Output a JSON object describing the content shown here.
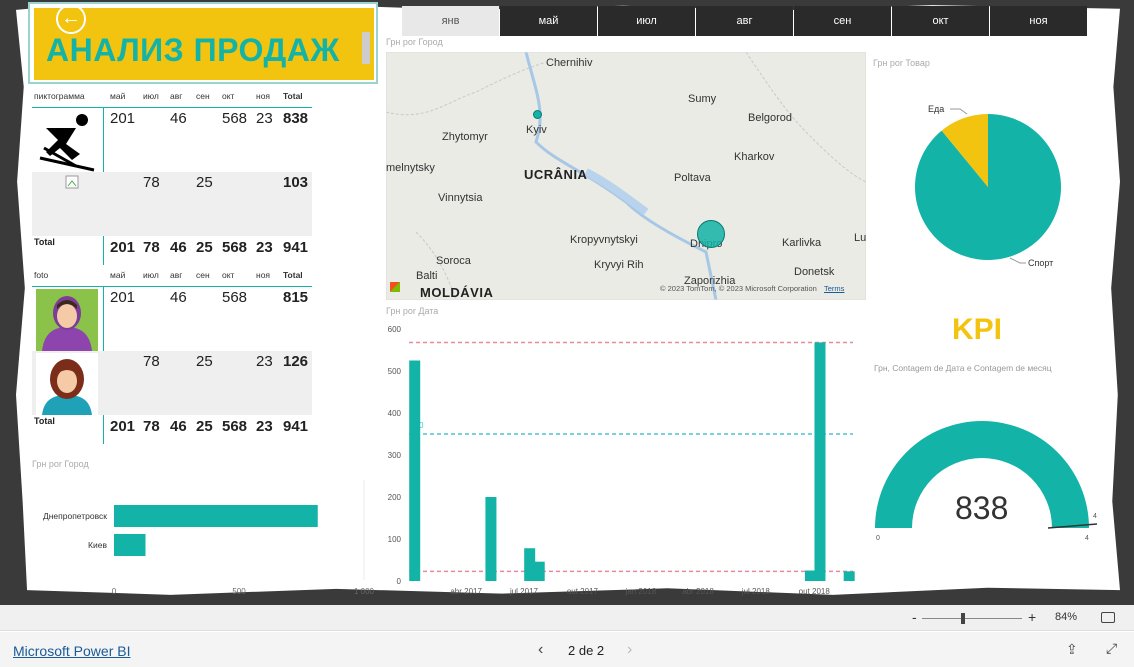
{
  "report": {
    "title": "АНАЛИЗ ПРОДАЖ",
    "accent": "#13B3A7",
    "yellow": "#F2C30F"
  },
  "tabs": [
    {
      "label": "янв",
      "active": true
    },
    {
      "label": "май",
      "active": false
    },
    {
      "label": "июл",
      "active": false
    },
    {
      "label": "авг",
      "active": false
    },
    {
      "label": "сен",
      "active": false
    },
    {
      "label": "окт",
      "active": false
    },
    {
      "label": "ноя",
      "active": false
    }
  ],
  "table1": {
    "headers": [
      "пиктограмма",
      "май",
      "июл",
      "авг",
      "сен",
      "окт",
      "ноя",
      "Total"
    ],
    "rows": [
      {
        "icon": "skier-icon",
        "values": [
          "201",
          "",
          "46",
          "",
          "568",
          "23"
        ],
        "total": "838"
      },
      {
        "icon": "broken-image-icon",
        "values": [
          "",
          "78",
          "",
          "25",
          "",
          ""
        ],
        "total": "103"
      }
    ],
    "total_row": {
      "label": "Total",
      "values": [
        "201",
        "78",
        "46",
        "25",
        "568",
        "23"
      ],
      "total": "941"
    }
  },
  "table2": {
    "headers": [
      "foto",
      "май",
      "июл",
      "авг",
      "сен",
      "окт",
      "ноя",
      "Total"
    ],
    "rows": [
      {
        "icon": "man-avatar-icon",
        "values": [
          "201",
          "",
          "46",
          "",
          "568",
          ""
        ],
        "total": "815"
      },
      {
        "icon": "woman-avatar-icon",
        "values": [
          "",
          "78",
          "",
          "25",
          "",
          "23"
        ],
        "total": "126"
      }
    ],
    "total_row": {
      "label": "Total",
      "values": [
        "201",
        "78",
        "46",
        "25",
        "568",
        "23"
      ],
      "total": "941"
    }
  },
  "map": {
    "title": "Грн por Город",
    "countries": [
      "UCRÂNIA",
      "MOLDÁVIA"
    ],
    "cities": [
      "Chernihiv",
      "Sumy",
      "Kyiv",
      "Zhytomyr",
      "Belgorod",
      "Kharkov",
      "melnytsky",
      "Poltava",
      "Vinnytsia",
      "Kropyvnytskyi",
      "Dnipro",
      "Karlivka",
      "Soroca",
      "Kryvyi Rih",
      "Balti",
      "Zaporizhia",
      "Donetsk",
      "Lu"
    ],
    "copyright": "© 2023 TomTom, © 2023 Microsoft Corporation",
    "terms": "Terms"
  },
  "pie": {
    "title": "Грн por Товар"
  },
  "bar_chart": {
    "title": "Грн por Город"
  },
  "column_chart": {
    "title": "Грн por Дата"
  },
  "kpi": {
    "title": "KPI",
    "subtitle": "Грн, Contagem de Дата e Contagem de месяц",
    "value": "838",
    "min_label": "0",
    "max_label": "4",
    "target_label": "4"
  },
  "zoom": {
    "minus": "-",
    "plus": "+",
    "level": "84%"
  },
  "footer": {
    "brand": "Microsoft Power BI",
    "page": "2 de 2"
  },
  "chart_data": [
    {
      "type": "pie",
      "title": "Грн por Товар",
      "categories": [
        "Спорт",
        "Еда"
      ],
      "values": [
        838,
        103
      ]
    },
    {
      "type": "bar",
      "title": "Грн por Город",
      "categories": [
        "Днепропетровск",
        "Киев"
      ],
      "values": [
        815,
        126
      ],
      "xlim": [
        0,
        1000
      ],
      "xticks": [
        "0",
        "500",
        "1 000"
      ]
    },
    {
      "type": "bar",
      "title": "Грн por Дата",
      "ylim": [
        0,
        600
      ],
      "yticks": [
        "0",
        "100",
        "200",
        "300",
        "400",
        "500",
        "600"
      ],
      "xticks": [
        "abr 2017",
        "jul 2017",
        "out 2017",
        "jan 2018",
        "abr 2018",
        "jul 2018",
        "out 2018"
      ],
      "x": [
        "2017-01-10",
        "2017-05-10",
        "2017-07-10",
        "2017-07-25",
        "2018-09-25",
        "2018-10-10",
        "2018-11-25"
      ],
      "values": [
        525,
        200,
        78,
        46,
        25,
        568,
        23
      ],
      "reference_lines": [
        568,
        350,
        23
      ],
      "reference_label": "0"
    },
    {
      "type": "gauge",
      "title": "Грн, Contagem de Дата e Contagem de месяц",
      "value": 838,
      "min": 0,
      "max": 4,
      "target": 4
    }
  ]
}
